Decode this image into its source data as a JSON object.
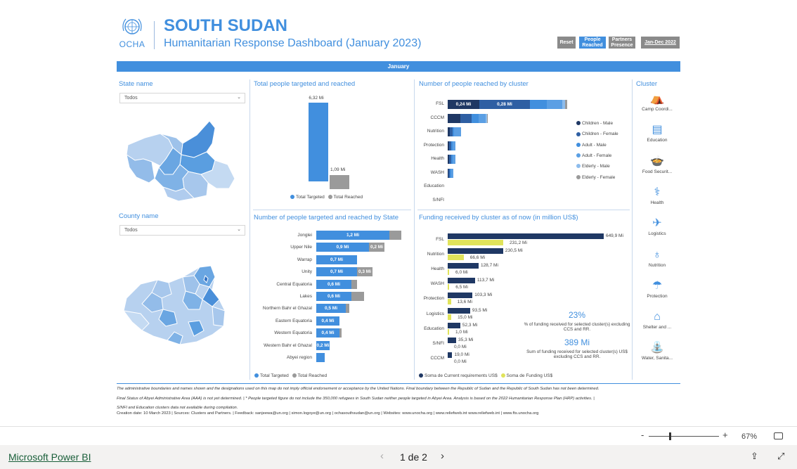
{
  "header": {
    "org": "OCHA",
    "title": "SOUTH SUDAN",
    "subtitle": "Humanitarian Response Dashboard (January 2023)",
    "buttons": [
      "Reset",
      "People Reached",
      "Partners Presence",
      "Jan-Dec 2022"
    ],
    "month_bar": "January"
  },
  "filters": {
    "state_label": "State name",
    "state_value": "Todos",
    "county_label": "County name",
    "county_value": "Todos"
  },
  "sections": {
    "total": "Total people targeted and reached",
    "by_state": "Number of people targeted and reached by State",
    "by_cluster": "Number of people reached by cluster",
    "funding": "Funding received by cluster as of now (in million US$)",
    "cluster": "Cluster"
  },
  "total_chart": {
    "targeted_label": "6,32 Mi",
    "reached_label": "1,09 Mi",
    "legend": [
      "Total Targeted",
      "Total Reached"
    ]
  },
  "state_chart": {
    "rows": [
      {
        "name": "Jonglei",
        "targeted": "1,2 Mi",
        "reached": ""
      },
      {
        "name": "Upper Nile",
        "targeted": "0,9 Mi",
        "reached": "0,2 Mi"
      },
      {
        "name": "Warrap",
        "targeted": "0,7 Mi",
        "reached": ""
      },
      {
        "name": "Unity",
        "targeted": "0,7 Mi",
        "reached": "0,3 Mi"
      },
      {
        "name": "Central Equatoria",
        "targeted": "0,6 Mi",
        "reached": ""
      },
      {
        "name": "Lakes",
        "targeted": "0,6 Mi",
        "reached": ""
      },
      {
        "name": "Northern Bahr el Ghazal",
        "targeted": "0,5 Mi",
        "reached": ""
      },
      {
        "name": "Eastern Equatoria",
        "targeted": "0,4 Mi",
        "reached": ""
      },
      {
        "name": "Western Equatoria",
        "targeted": "0,4 Mi",
        "reached": ""
      },
      {
        "name": "Western Bahr el Ghazal",
        "targeted": "0,2 Mi",
        "reached": ""
      },
      {
        "name": "Abyei region",
        "targeted": "",
        "reached": ""
      }
    ],
    "legend": [
      "Total Targeted",
      "Total Reached"
    ]
  },
  "cluster_chart": {
    "rows": [
      "FSL",
      "CCCM",
      "Nutrition",
      "Protection",
      "Health",
      "WASH",
      "Education",
      "S/NFI"
    ],
    "fsl_labels": [
      "0,24 Mi",
      "0,28 Mi"
    ],
    "legend": [
      "Children - Male",
      "Children - Female",
      "Adult - Male",
      "Adult - Female",
      "Elderly - Male",
      "Elderly - Female"
    ]
  },
  "funding_chart": {
    "rows": [
      {
        "name": "FSL",
        "req": "649,9 Mi",
        "fund": "231,2 Mi"
      },
      {
        "name": "Nutrition",
        "req": "230,5 Mi",
        "fund": "66,6 Mi"
      },
      {
        "name": "Health",
        "req": "128,7 Mi",
        "fund": "6,0 Mi"
      },
      {
        "name": "WASH",
        "req": "113,7 Mi",
        "fund": "6,5 Mi"
      },
      {
        "name": "Protection",
        "req": "103,3 Mi",
        "fund": "13,6 Mi"
      },
      {
        "name": "Logistics",
        "req": "93,5 Mi",
        "fund": "15,0 Mi"
      },
      {
        "name": "Education",
        "req": "52,3 Mi",
        "fund": "1,0 Mi"
      },
      {
        "name": "S/NFI",
        "req": "35,3 Mi",
        "fund": "0,0 Mi"
      },
      {
        "name": "CCCM",
        "req": "19,0 Mi",
        "fund": "0,0 Mi"
      }
    ],
    "legend": [
      "Soma de Current requirements US$",
      "Soma de Funding US$"
    ],
    "kpi1_value": "23%",
    "kpi1_text": "% of funding received for selected cluster(s) excluding CCS and RR.",
    "kpi2_value": "389 Mi",
    "kpi2_text": "Sum of funding received  for selected cluster(s) US$ excluding CCS and RR."
  },
  "clusters": [
    {
      "label": "Camp Coordi...",
      "icon": "camp-icon"
    },
    {
      "label": "Education",
      "icon": "book-icon"
    },
    {
      "label": "Food Securit...",
      "icon": "food-icon"
    },
    {
      "label": "Health",
      "icon": "health-icon"
    },
    {
      "label": "Logistics",
      "icon": "logistics-icon"
    },
    {
      "label": "Nutrition",
      "icon": "nutrition-icon"
    },
    {
      "label": "Protection",
      "icon": "protection-icon"
    },
    {
      "label": "Shelter and ...",
      "icon": "shelter-icon"
    },
    {
      "label": "Water, Sanita...",
      "icon": "water-icon"
    }
  ],
  "footer": {
    "line1": "The administrative boundaries and names shown and the designations used on this map do not imply official endorsement or acceptance by the United Nations. Final boundary between the Republic of Sudan and the Republic of South Sudan has not been determined.",
    "line2": "Final Status of Abyei Administrative Area (AAA) is not yet determined.  |  * People targeted figure do not include the 350,000 refugees in South Sudan neither people targeted in Abyei Area. Analysis is based on the 2022 Humanitarian Response Plan (HRP) activities.  |",
    "line3": "S/NFI and Education clusters data not available during compilation.",
    "line4": "Creation date: 10 March 2023  |  Sources: Clusters and Partners.  |  Feedback: sanjeewa@un.org  |  simon.logoye@un.org  |  ochasouthsudan@un.org  |  Websites: www.unocha.org  |  www.reliefweb.int   www.reliefweb.int  |  www.fts.unocha.org"
  },
  "viewer": {
    "zoom_minus": "-",
    "zoom_plus": "+",
    "zoom_level": "67%",
    "brand": "Microsoft Power BI",
    "page": "1 de 2"
  },
  "colors": {
    "accent": "#418fde",
    "dark": "#1f3864",
    "gray": "#999999",
    "yellow": "#e0e35b"
  }
}
